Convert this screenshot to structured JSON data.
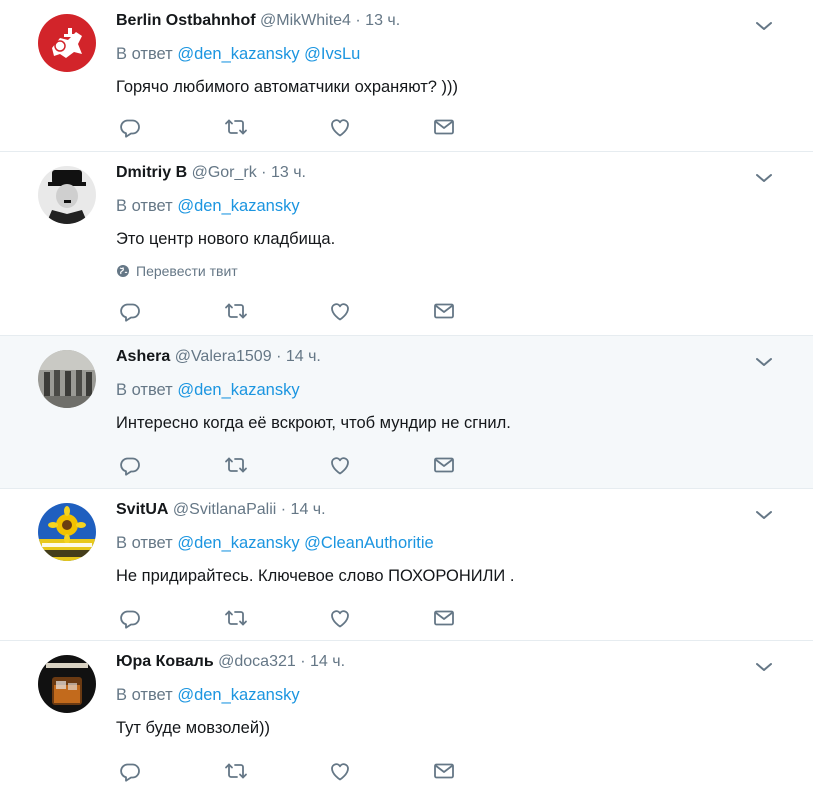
{
  "tweets": [
    {
      "name": "Berlin Ostbahnhof",
      "handle": "@MikWhite4",
      "separator": "·",
      "time": "13 ч.",
      "reply_prefix": "В ответ",
      "mentions": [
        "@den_kazansky",
        "@IvsLu"
      ],
      "text": "Горячо любимого автоматчики охраняют? )))"
    },
    {
      "name": "Dmitriy B",
      "handle": "@Gor_rk",
      "separator": "·",
      "time": "13 ч.",
      "reply_prefix": "В ответ",
      "mentions": [
        "@den_kazansky"
      ],
      "text": "Это центр нового кладбища.",
      "translate": "Перевести твит"
    },
    {
      "name": "Ashera",
      "handle": "@Valera1509",
      "separator": "·",
      "time": "14 ч.",
      "reply_prefix": "В ответ",
      "mentions": [
        "@den_kazansky"
      ],
      "text": "Интересно когда её вскроют, чтоб мундир не сгнил."
    },
    {
      "name": "SvitUA",
      "handle": "@SvitlanaPalii",
      "separator": "·",
      "time": "14 ч.",
      "reply_prefix": "В ответ",
      "mentions": [
        "@den_kazansky",
        "@CleanAuthoritie"
      ],
      "text": "Не придирайтесь.  Ключевое слово  ПОХОРОНИЛИ ."
    },
    {
      "name": "Юра Коваль",
      "handle": "@doca321",
      "separator": "·",
      "time": "14 ч.",
      "reply_prefix": "В ответ",
      "mentions": [
        "@den_kazansky"
      ],
      "text": "Тут буде мовзолей))"
    }
  ],
  "icons": {
    "reply": "reply-icon",
    "retweet": "retweet-icon",
    "like": "like-icon",
    "dm": "direct-message-icon",
    "caret": "chevron-down-icon",
    "globe": "globe-icon"
  },
  "colors": {
    "mention": "#1b95e0",
    "muted": "#657786",
    "highlight_bg": "#f5f8fa",
    "divider": "#e6ecf0"
  }
}
